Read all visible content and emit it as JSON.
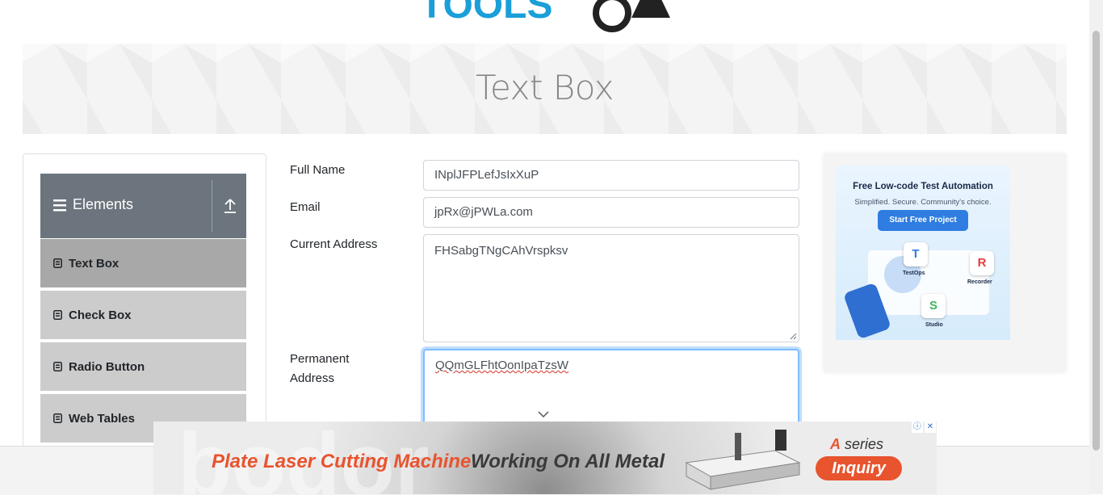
{
  "header": {
    "logo_text": "TOOLSQA"
  },
  "banner": {
    "title": "Text Box"
  },
  "sidebar": {
    "group_title": "Elements",
    "items": [
      {
        "label": "Text Box",
        "active": true
      },
      {
        "label": "Check Box"
      },
      {
        "label": "Radio Button"
      },
      {
        "label": "Web Tables"
      }
    ]
  },
  "form": {
    "full_name": {
      "label": "Full Name",
      "value": "INplJFPLefJsIxXuP"
    },
    "email": {
      "label": "Email",
      "value": "jpRx@jPWLa.com"
    },
    "current_address": {
      "label": "Current Address",
      "value": "FHSabgTNgCAhVrspksv"
    },
    "permanent_address": {
      "label_line1": "Permanent",
      "label_line2": "Address",
      "value": "QQmGLFhtOonIpaTzsW"
    }
  },
  "right_ad": {
    "headline": "Free Low-code Test Automation",
    "subline": "Simplified. Secure. Community's choice.",
    "button": "Start Free Project",
    "tiles": [
      "TestOps",
      "Recorder",
      "Studio"
    ]
  },
  "bottom_ad": {
    "brand_watermark": "bodor",
    "headline_part1": "Plate Laser Cutting Machine",
    "headline_part2": "Working On All Metal",
    "series_letter": "A",
    "series_word": "series",
    "cta": "Inquiry"
  },
  "colors": {
    "accent": "#6c757d",
    "ad_orange": "#e8542e",
    "focus": "#80bdff"
  }
}
